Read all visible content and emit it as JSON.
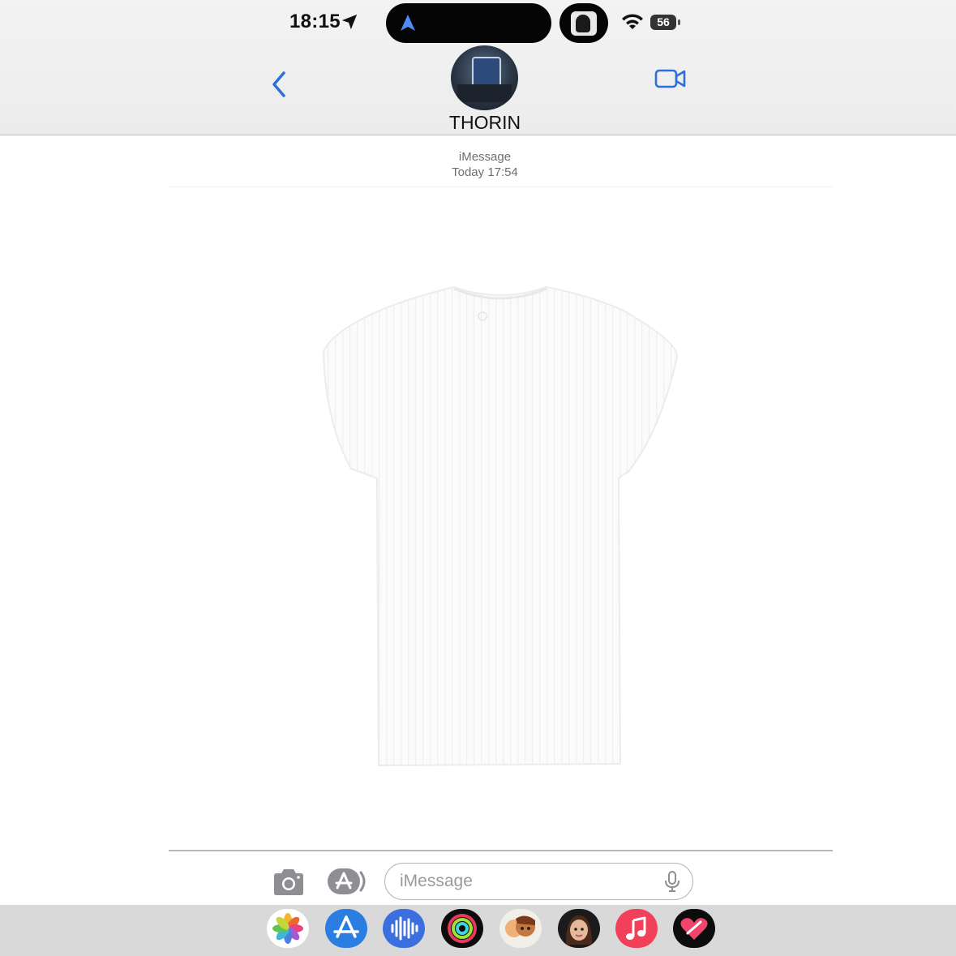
{
  "status_bar": {
    "time": "18:15",
    "battery": "56",
    "location_icon": "location-arrow-icon",
    "wifi_icon": "wifi-icon",
    "island_icon": "navigation-arrow-icon"
  },
  "header": {
    "contact_name": "THORIN",
    "back_icon": "chevron-left-icon",
    "video_icon": "video-camera-icon",
    "accent_color": "#2f6fd8"
  },
  "thread": {
    "service": "iMessage",
    "timestamp": "Today 17:54",
    "attachment": "white-ribbed-tshirt-photo"
  },
  "composer": {
    "placeholder": "iMessage",
    "camera_icon": "camera-icon",
    "apps_icon": "app-store-icon",
    "mic_icon": "microphone-icon"
  },
  "app_drawer": [
    {
      "name": "photos",
      "icon": "photos-icon"
    },
    {
      "name": "app-store",
      "icon": "app-store-icon"
    },
    {
      "name": "audio-message",
      "icon": "waveform-icon"
    },
    {
      "name": "activity",
      "icon": "activity-rings-icon"
    },
    {
      "name": "memoji-stickers",
      "icon": "memoji-icon"
    },
    {
      "name": "memoji",
      "icon": "memoji-face-icon"
    },
    {
      "name": "music",
      "icon": "music-note-icon"
    },
    {
      "name": "digital-touch",
      "icon": "heart-icon"
    }
  ]
}
